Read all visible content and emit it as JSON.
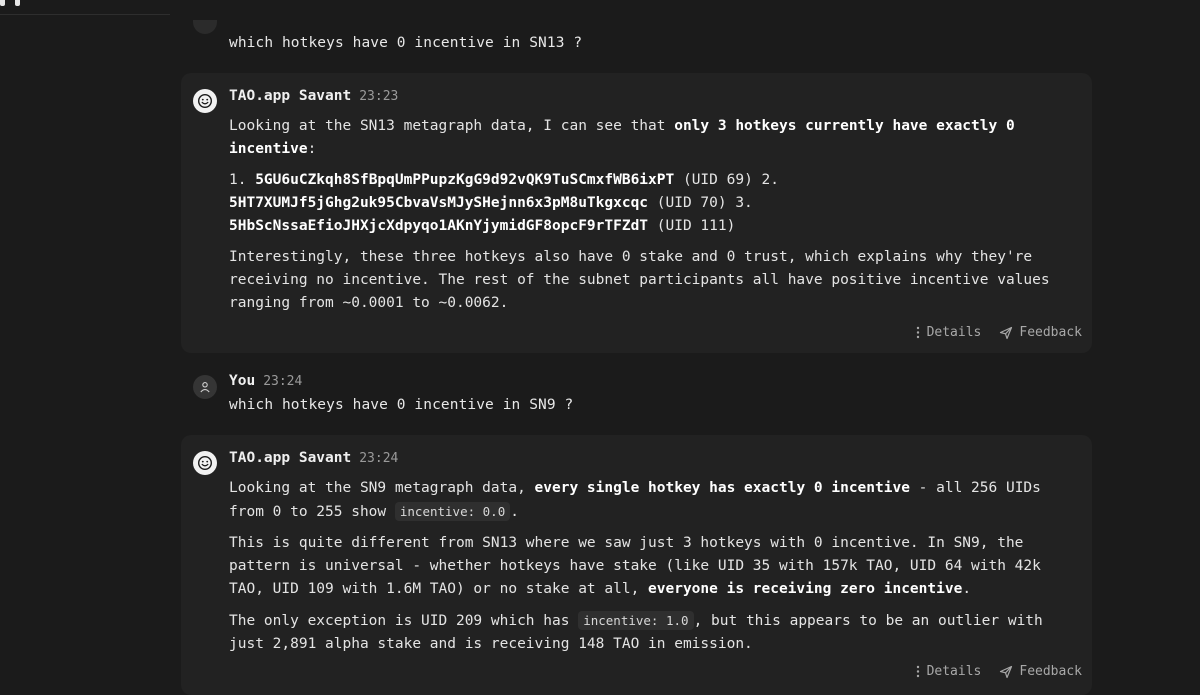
{
  "conversation": {
    "prev_question": "which hotkeys have 0 incentive in SN13 ?",
    "reply1": {
      "sender": "TAO.app Savant",
      "time": "23:23",
      "p1_pre": "Looking at the SN13 metagraph data, I can see that ",
      "p1_bold": "only 3 hotkeys currently have exactly 0 incentive",
      "p1_post": ":",
      "list_n1": "1. ",
      "key1": "5GU6uCZkqh8SfBpqUmPPupzKgG9d92vQK9TuSCmxfWB6ixPT",
      "uid1": " (UID 69) 2.",
      "key2": "5HT7XUMJf5jGhg2uk95CbvaVsMJySHejnn6x3pM8uTkgxcqc",
      "uid2": " (UID 70) 3.",
      "key3": "5HbScNssaEfioJHXjcXdpyqo1AKnYjymidGF8opcF9rTFZdT",
      "uid3": " (UID 111)",
      "p3": "Interestingly, these three hotkeys also have 0 stake and 0 trust, which explains why they're receiving no incentive. The rest of the subnet participants all have positive incentive values ranging from ~0.0001 to ~0.0062.",
      "details": "Details",
      "feedback": "Feedback"
    },
    "user2": {
      "sender": "You",
      "time": "23:24",
      "text": "which hotkeys have 0 incentive in SN9 ?"
    },
    "reply2": {
      "sender": "TAO.app Savant",
      "time": "23:24",
      "p1_pre": "Looking at the SN9 metagraph data, ",
      "p1_bold": "every single hotkey has exactly 0 incentive",
      "p1_mid": " - all 256 UIDs from 0 to 255 show ",
      "p1_code": "incentive: 0.0",
      "p1_post": ".",
      "p2_pre": "This is quite different from SN13 where we saw just 3 hotkeys with 0 incentive. In SN9, the pattern is universal - whether hotkeys have stake (like UID 35 with 157k TAO, UID 64 with 42k TAO, UID 109 with 1.6M TAO) or no stake at all, ",
      "p2_bold": "everyone is receiving zero incentive",
      "p2_post": ".",
      "p3_pre": "The only exception is UID 209 which has ",
      "p3_code": "incentive: 1.0",
      "p3_post": ", but this appears to be an outlier with just 2,891 alpha stake and is receiving 148 TAO in emission.",
      "details": "Details",
      "feedback": "Feedback"
    }
  },
  "icons": {
    "bot_avatar": "smiley-icon",
    "user_avatar": "user-icon",
    "details": "vertical-dots-icon",
    "feedback": "send-icon"
  }
}
